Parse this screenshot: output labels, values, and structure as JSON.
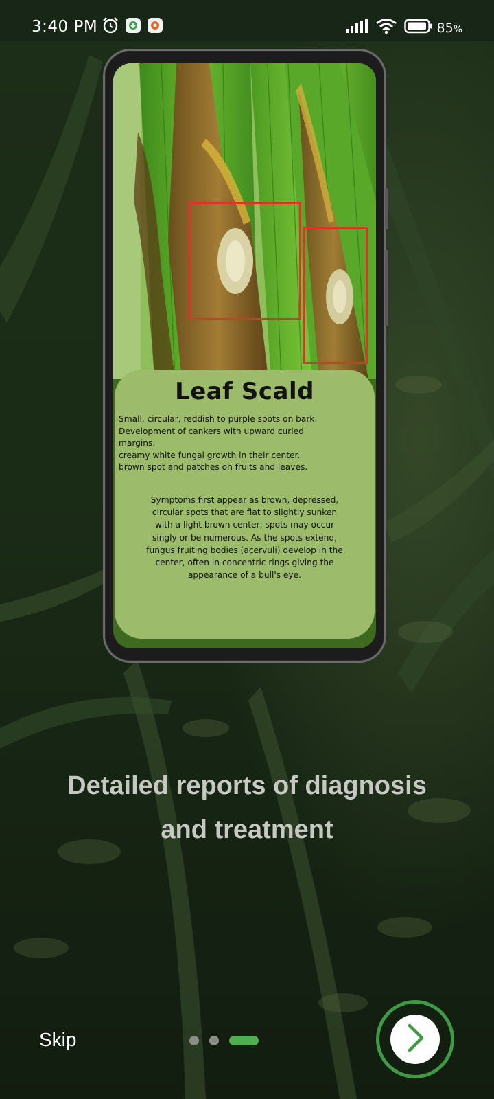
{
  "status_bar": {
    "time": "3:40 PM",
    "battery": "85",
    "battery_unit": "%",
    "icons": [
      "alarm-icon",
      "download-app-icon",
      "notification-app-icon",
      "signal-icon",
      "wifi-icon",
      "battery-icon"
    ]
  },
  "preview_card": {
    "title": "Leaf Scald",
    "points": [
      "Small, circular, reddish to purple spots on bark.",
      "Development of cankers with upward curled",
      "margins.",
      "creamy white fungal growth in their center.",
      "brown spot and patches on fruits and leaves."
    ],
    "description": [
      "Symptoms first appear as brown, depressed,",
      "circular spots that are flat to slightly sunken",
      "with a light brown center; spots may occur",
      "singly or be numerous. As the spots extend,",
      "fungus fruiting bodies (acervuli) develop in the",
      "center, often in concentric rings giving the",
      "appearance of a bull's eye."
    ]
  },
  "headline": {
    "line1": "Detailed reports of diagnosis",
    "line2": "and treatment"
  },
  "controls": {
    "skip_label": "Skip",
    "current_page": 3,
    "total_pages": 3,
    "next_icon": "chevron-right-icon"
  },
  "colors": {
    "accent": "#4fae4f",
    "card": "#9cbb6b",
    "detection_box": "#e0322b",
    "headline": "#c5c9c1"
  }
}
